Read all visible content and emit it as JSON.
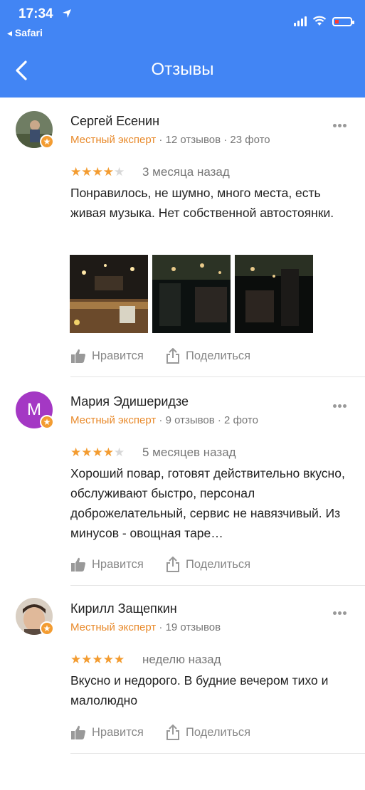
{
  "status": {
    "time": "17:34",
    "back_app": "◂ Safari"
  },
  "header": {
    "title": "Отзывы"
  },
  "reviews": [
    {
      "name": "Сергей Есенин",
      "expert": "Местный эксперт",
      "meta": " · 12 отзывов · 23 фото",
      "rating": 4,
      "date": "3 месяца назад",
      "text": "Понравилось, не шумно, много места, есть живая музыка. Нет собственной автостоянки.",
      "photos": 3
    },
    {
      "name": "Мария Эдишеридзе",
      "avatar_letter": "M",
      "expert": "Местный эксперт",
      "meta": " · 9 отзывов · 2 фото",
      "rating": 4,
      "date": "5 месяцев назад",
      "text": "Хороший повар, готовят действительно вкусно, обслуживают быстро, персонал доброжелательный, сервис не навязчивый. Из минусов - овощная таре…"
    },
    {
      "name": "Кирилл Защепкин",
      "expert": "Местный эксперт",
      "meta": " · 19 отзывов",
      "rating": 5,
      "date": "неделю назад",
      "text": "Вкусно и недорого. В будние вечером тихо и малолюдно"
    }
  ],
  "actions": {
    "like": "Нравится",
    "share": "Поделиться"
  },
  "colors": {
    "header": "#4285f4",
    "star": "#f39c31",
    "expert": "#e8892a"
  }
}
